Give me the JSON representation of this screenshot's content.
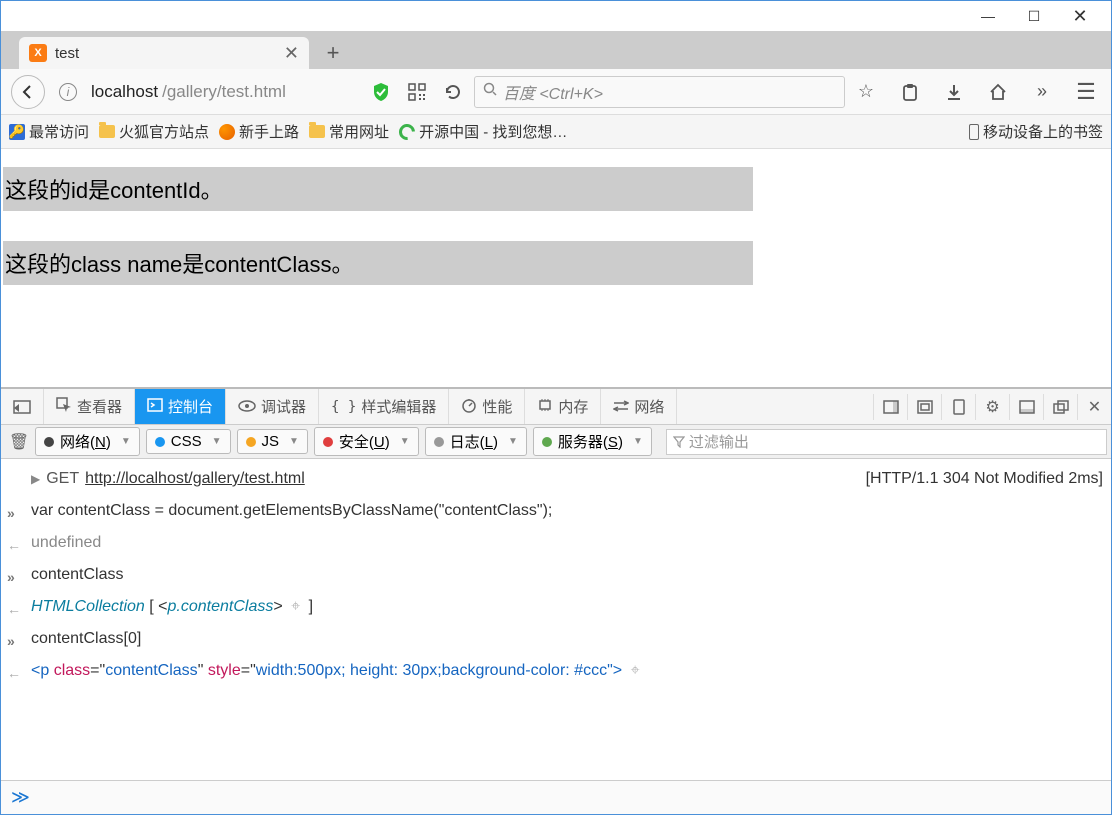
{
  "window": {
    "minimize": "—",
    "maximize": "☐",
    "close": "✕"
  },
  "tab": {
    "favicon_label": "X",
    "title": "test",
    "close": "✕",
    "newtab": "+"
  },
  "addressbar": {
    "info": "i",
    "url_host": "localhost",
    "url_path": "/gallery/test.html",
    "search_placeholder": "百度 <Ctrl+K>"
  },
  "bookmarks": {
    "most_visited": "最常访问",
    "firefox_official": "火狐官方站点",
    "getting_started": "新手上路",
    "common_urls": "常用网址",
    "oschina": "开源中国 - 找到您想…",
    "mobile": "移动设备上的书签"
  },
  "page": {
    "p1": "这段的id是contentId。",
    "p2": "这段的class name是contentClass。"
  },
  "devtools": {
    "tabs": {
      "inspector": "查看器",
      "console": "控制台",
      "debugger": "调试器",
      "style": "样式编辑器",
      "performance": "性能",
      "memory": "内存",
      "network": "网络"
    },
    "filters": {
      "net": "网络(N)",
      "css": "CSS",
      "js": "JS",
      "security": "安全(U)",
      "log": "日志(L)",
      "server": "服务器(S)",
      "filter_placeholder": "过滤输出"
    },
    "console": {
      "net_method": "GET",
      "net_url": "http://localhost/gallery/test.html",
      "net_status": "[HTTP/1.1 304 Not Modified 2ms]",
      "line1": "var contentClass = document.getElementsByClassName(\"contentClass\");",
      "line2": "undefined",
      "line3": "contentClass",
      "line4_prefix": "HTMLCollection",
      "line4_open": " [ <",
      "line4_tag": "p.contentClass",
      "line4_close": "> ",
      "line4_end": " ]",
      "line5": "contentClass[0]",
      "line6_open": "<",
      "line6_tag": "p",
      "line6_sp": " ",
      "line6_classattr": "class",
      "line6_eq": "=\"",
      "line6_classval": "contentClass",
      "line6_q": "\" ",
      "line6_styleattr": "style",
      "line6_eq2": "=\"",
      "line6_styleval": "width:500px; height: 30px;background-color: #ccc",
      "line6_close": "\">"
    },
    "prompt": "≫"
  }
}
